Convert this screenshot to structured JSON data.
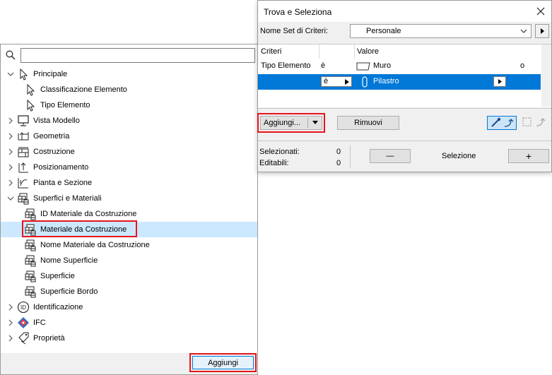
{
  "tree": {
    "search": {
      "value": "",
      "placeholder": ""
    },
    "items": [
      {
        "label": "Principale",
        "icon": "pointer-icon",
        "expanded": true,
        "level": 0
      },
      {
        "label": "Classificazione Elemento",
        "icon": "pointer-icon",
        "level": 1
      },
      {
        "label": "Tipo Elemento",
        "icon": "pointer-icon",
        "level": 1
      },
      {
        "label": "Vista Modello",
        "icon": "monitor-icon",
        "expanded": false,
        "level": 0
      },
      {
        "label": "Geometria",
        "icon": "geometry-icon",
        "expanded": false,
        "level": 0
      },
      {
        "label": "Costruzione",
        "icon": "construction-icon",
        "expanded": false,
        "level": 0
      },
      {
        "label": "Posizionamento",
        "icon": "positioning-icon",
        "expanded": false,
        "level": 0
      },
      {
        "label": "Pianta e Sezione",
        "icon": "plan-section-icon",
        "expanded": false,
        "level": 0
      },
      {
        "label": "Superfici e Materiali",
        "icon": "materials-icon",
        "expanded": true,
        "level": 0
      },
      {
        "label": "ID Materiale da Costruzione",
        "icon": "materials-icon",
        "level": 1
      },
      {
        "label": "Materiale da Costruzione",
        "icon": "materials-icon",
        "level": 1,
        "selected": true
      },
      {
        "label": "Nome Materiale da Costruzione",
        "icon": "materials-icon",
        "level": 1
      },
      {
        "label": "Nome Superficie",
        "icon": "materials-icon",
        "level": 1
      },
      {
        "label": "Superficie",
        "icon": "materials-icon",
        "level": 1
      },
      {
        "label": "Superficie Bordo",
        "icon": "materials-icon",
        "level": 1
      },
      {
        "label": "Identificazione",
        "icon": "id-icon",
        "expanded": false,
        "level": 0
      },
      {
        "label": "IFC",
        "icon": "ifc-icon",
        "expanded": false,
        "level": 0
      },
      {
        "label": "Proprietà",
        "icon": "properties-icon",
        "expanded": false,
        "level": 0
      }
    ],
    "add_button_label": "Aggiungi"
  },
  "find_select": {
    "title": "Trova e Seleziona",
    "criteria_set_label": "Nome Set di Criteri:",
    "criteria_set_value": "Personale",
    "columns": [
      "Criteri",
      "Valore"
    ],
    "rows": [
      {
        "criterion": "Tipo Elemento",
        "operator": "è",
        "value": "Muro",
        "connector": "o",
        "value_icon": "wall-icon"
      },
      {
        "criterion": "",
        "operator": "è",
        "value": "Pilastro",
        "connector": "",
        "value_icon": "column-icon",
        "selected": true
      }
    ],
    "add_button_label": "Aggiungi...",
    "remove_button_label": "Rimuovi",
    "selected_label": "Selezionati:",
    "selected_count": "0",
    "editable_label": "Editabili:",
    "editable_count": "0",
    "selection_label": "Selezione",
    "minus_label": "—",
    "plus_label": "+"
  },
  "colors": {
    "selection_blue": "#0078d7",
    "tree_selected": "#cce8ff",
    "highlight_red": "#e8141c",
    "panel_bg": "#f0f0f0"
  }
}
